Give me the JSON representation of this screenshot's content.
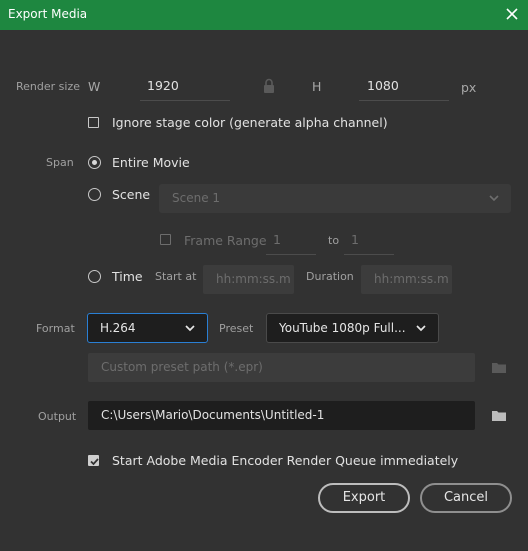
{
  "window": {
    "title": "Export Media",
    "titlebar_color": "#1e8740"
  },
  "render_size": {
    "label": "Render size",
    "width_label": "W",
    "width_value": "1920",
    "height_label": "H",
    "height_value": "1080",
    "unit": "px",
    "lock_icon": "lock-icon"
  },
  "ignore_stage": {
    "label": "Ignore stage color (generate alpha channel)",
    "checked": false
  },
  "span": {
    "label": "Span",
    "entire_movie_label": "Entire Movie",
    "scene_label": "Scene",
    "scene_select_value": "Scene 1",
    "frame_range": {
      "label": "Frame Range",
      "from": "1",
      "to_label": "to",
      "to": "1",
      "checked": false
    },
    "time": {
      "label": "Time",
      "start_label": "Start at",
      "start_placeholder": "hh:mm:ss.m",
      "duration_label": "Duration",
      "duration_placeholder": "hh:mm:ss.m"
    },
    "selected": "Entire Movie"
  },
  "format": {
    "label": "Format",
    "value": "H.264",
    "preset_label": "Preset",
    "preset_value": "YouTube 1080p Full...",
    "custom_preset_placeholder": "Custom preset path (*.epr)",
    "accent_color": "#2a7fd4"
  },
  "output": {
    "label": "Output",
    "path": "C:\\Users\\Mario\\Documents\\Untitled-1"
  },
  "render_queue": {
    "label": "Start Adobe Media Encoder Render Queue immediately",
    "checked": true
  },
  "buttons": {
    "export": "Export",
    "cancel": "Cancel"
  }
}
